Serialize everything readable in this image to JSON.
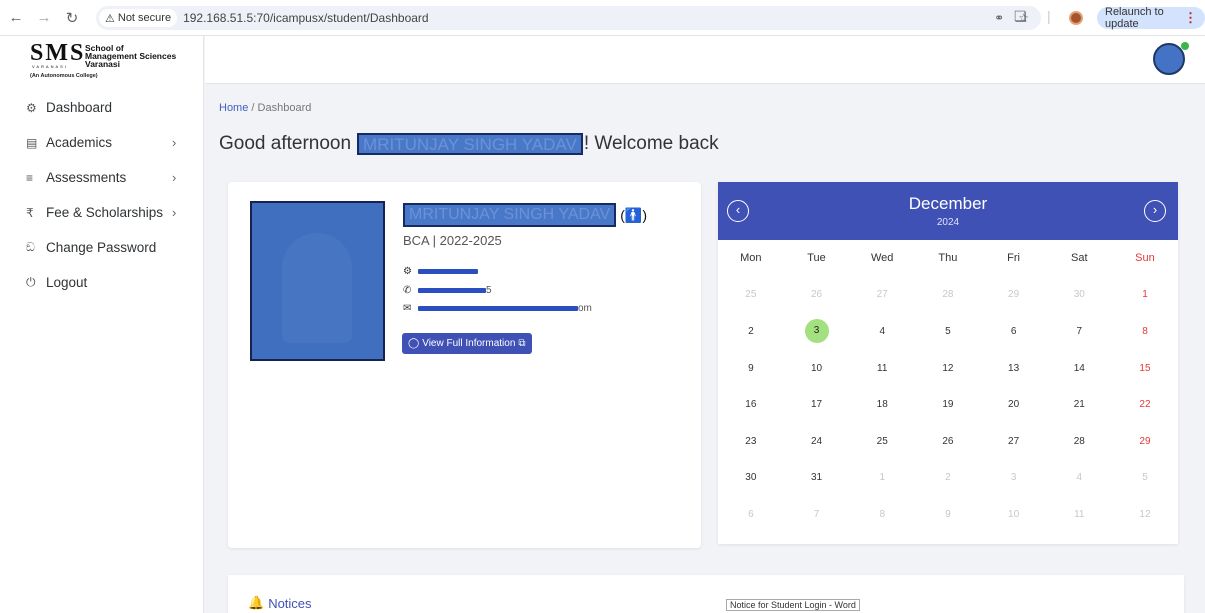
{
  "browser": {
    "security_label": "Not secure",
    "url": "192.168.51.5:70/icampusx/student/Dashboard",
    "relaunch_label": "Relaunch to update"
  },
  "logo": {
    "line1": "School of",
    "line2": "Management Sciences",
    "line3": "Varanasi",
    "sms": "SMS",
    "varanasi_spaced": "VARANASI",
    "subtitle": "(An Autonomous College)"
  },
  "sidebar": {
    "items": [
      {
        "label": "Dashboard",
        "icon": "dashboard-icon",
        "glyph": "⚙"
      },
      {
        "label": "Academics",
        "icon": "book-icon",
        "glyph": "▤"
      },
      {
        "label": "Assessments",
        "icon": "list-icon",
        "glyph": "≡"
      },
      {
        "label": "Fee & Scholarships",
        "icon": "rupee-icon",
        "glyph": "₹"
      },
      {
        "label": "Change Password",
        "icon": "key-icon",
        "glyph": "ඞ"
      },
      {
        "label": "Logout",
        "icon": "power-icon",
        "glyph": "⏻"
      }
    ]
  },
  "breadcrumb": {
    "home": "Home",
    "separator": "/",
    "current": "Dashboard"
  },
  "greeting": {
    "prefix": "Good afternoon",
    "name": "MRITUNJAY SINGH YADAV",
    "suffix": "! Welcome back"
  },
  "profile": {
    "name": "MRITUNJAY SINGH YADAV",
    "course": "BCA | 2022-2025",
    "phone_suffix": "5",
    "email_suffix": "om",
    "view_button": "View Full Information"
  },
  "calendar": {
    "month": "December",
    "year": "2024",
    "weekdays": [
      "Mon",
      "Tue",
      "Wed",
      "Thu",
      "Fri",
      "Sat",
      "Sun"
    ],
    "today": 3,
    "weeks": [
      [
        [
          "25",
          1
        ],
        [
          "26",
          1
        ],
        [
          "27",
          1
        ],
        [
          "28",
          1
        ],
        [
          "29",
          1
        ],
        [
          "30",
          1
        ],
        [
          "1",
          0
        ]
      ],
      [
        [
          "2",
          0
        ],
        [
          "3",
          0
        ],
        [
          "4",
          0
        ],
        [
          "5",
          0
        ],
        [
          "6",
          0
        ],
        [
          "7",
          0
        ],
        [
          "8",
          0
        ]
      ],
      [
        [
          "9",
          0
        ],
        [
          "10",
          0
        ],
        [
          "11",
          0
        ],
        [
          "12",
          0
        ],
        [
          "13",
          0
        ],
        [
          "14",
          0
        ],
        [
          "15",
          0
        ]
      ],
      [
        [
          "16",
          0
        ],
        [
          "17",
          0
        ],
        [
          "18",
          0
        ],
        [
          "19",
          0
        ],
        [
          "20",
          0
        ],
        [
          "21",
          0
        ],
        [
          "22",
          0
        ]
      ],
      [
        [
          "23",
          0
        ],
        [
          "24",
          0
        ],
        [
          "25",
          0
        ],
        [
          "26",
          0
        ],
        [
          "27",
          0
        ],
        [
          "28",
          0
        ],
        [
          "29",
          0
        ]
      ],
      [
        [
          "30",
          0
        ],
        [
          "31",
          0
        ],
        [
          "1",
          1
        ],
        [
          "2",
          1
        ],
        [
          "3",
          1
        ],
        [
          "4",
          1
        ],
        [
          "5",
          1
        ]
      ],
      [
        [
          "6",
          1
        ],
        [
          "7",
          1
        ],
        [
          "8",
          1
        ],
        [
          "9",
          1
        ],
        [
          "10",
          1
        ],
        [
          "11",
          1
        ],
        [
          "12",
          1
        ]
      ]
    ]
  },
  "notices": {
    "title": "Notices",
    "doc_label": "Notice for Student Login - Word"
  },
  "colors": {
    "accent": "#3f51b5",
    "sunday": "#e53935",
    "today": "#a3e07f"
  }
}
